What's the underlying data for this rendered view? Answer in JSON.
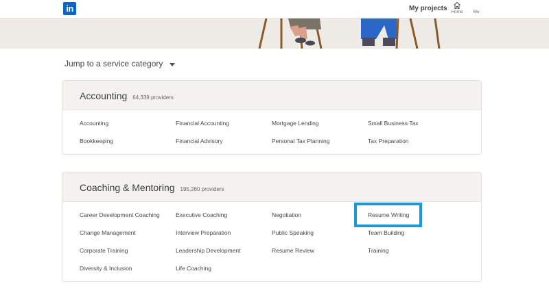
{
  "header": {
    "logo_text": "in",
    "my_projects": "My projects",
    "nav": {
      "home": "Home",
      "me": "Me"
    }
  },
  "jump": {
    "label": "Jump to a service category"
  },
  "categories": [
    {
      "title": "Accounting",
      "count": "64,339 providers",
      "columns": [
        [
          "Accounting",
          "Bookkeeping"
        ],
        [
          "Financial Accounting",
          "Financial Advisory"
        ],
        [
          "Mortgage Lending",
          "Personal Tax Planning"
        ],
        [
          "Small Business Tax",
          "Tax Preparation"
        ]
      ]
    },
    {
      "title": "Coaching & Mentoring",
      "count": "195,260 providers",
      "columns": [
        [
          "Career Development Coaching",
          "Change Management",
          "Corporate Training",
          "Diversity & Inclusion"
        ],
        [
          "Executive Coaching",
          "Interview Preparation",
          "Leadership Development",
          "Life Coaching"
        ],
        [
          "Negotiation",
          "Public Speaking",
          "Resume Review"
        ],
        [
          "Resume Writing",
          "Team Building",
          "Training"
        ]
      ]
    }
  ],
  "colors": {
    "linkedin_blue": "#0a66c2",
    "highlight": "#1a9bd7",
    "card_header_bg": "#f3f2ef",
    "hero_bg": "#eeebe6"
  }
}
